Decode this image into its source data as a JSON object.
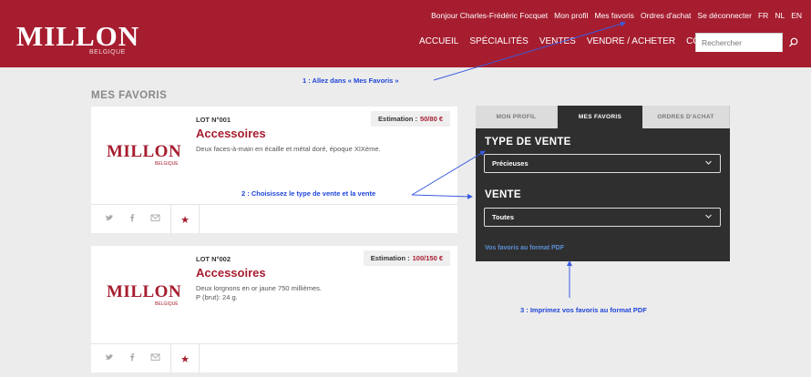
{
  "header": {
    "logo": "MILLON",
    "logo_sub": "BELGIQUE",
    "topbar": [
      {
        "label": "Bonjour Charles-Frédéric Focquet"
      },
      {
        "label": "Mon profil"
      },
      {
        "label": "Mes favoris"
      },
      {
        "label": "Ordres d'achat"
      },
      {
        "label": "Se déconnecter"
      },
      {
        "label": "FR"
      },
      {
        "label": "NL"
      },
      {
        "label": "EN"
      }
    ],
    "nav": [
      {
        "label": "ACCUEIL"
      },
      {
        "label": "SPÉCIALITÉS"
      },
      {
        "label": "VENTES"
      },
      {
        "label": "VENDRE / ACHETER"
      },
      {
        "label": "CONTACT"
      }
    ],
    "search_placeholder": "Rechercher",
    "brand_color": "#a61d2f"
  },
  "page_title": "MES FAVORIS",
  "lots": [
    {
      "logo": "MILLON",
      "logo_sub": "BELGIQUE",
      "lot_number": "LOT N°001",
      "estimation_label": "Estimation :",
      "estimation_value": "50/80 €",
      "title": "Accessoires",
      "description": "Deux faces-à-main en écaille et métal doré, époque XIXème."
    },
    {
      "logo": "MILLON",
      "logo_sub": "BELGIQUE",
      "lot_number": "LOT N°002",
      "estimation_label": "Estimation :",
      "estimation_value": "100/150 €",
      "title": "Accessoires",
      "description": "Deux lorgnons en or jaune 750 millièmes.\nP (brut): 24 g."
    }
  ],
  "share_icons": [
    "twitter-icon",
    "facebook-icon",
    "mail-icon",
    "star-icon"
  ],
  "panel": {
    "tabs": [
      {
        "label": "MON PROFIL",
        "active": false
      },
      {
        "label": "MES FAVORIS",
        "active": true
      },
      {
        "label": "ORDRES D'ACHAT",
        "active": false
      }
    ],
    "sale_type_heading": "TYPE DE VENTE",
    "sale_type_value": "Précieuses",
    "sale_heading": "VENTE",
    "sale_value": "Toutes",
    "pdf_link": "Vos favoris au format PDF"
  },
  "annotations": {
    "step1": "1 : Allez dans  « Mes Favoris »",
    "step2": "2 : Choisissez le type de vente et la vente",
    "step3": "3 : Imprimez vos favoris au format PDF",
    "color": "#1f45d8"
  }
}
